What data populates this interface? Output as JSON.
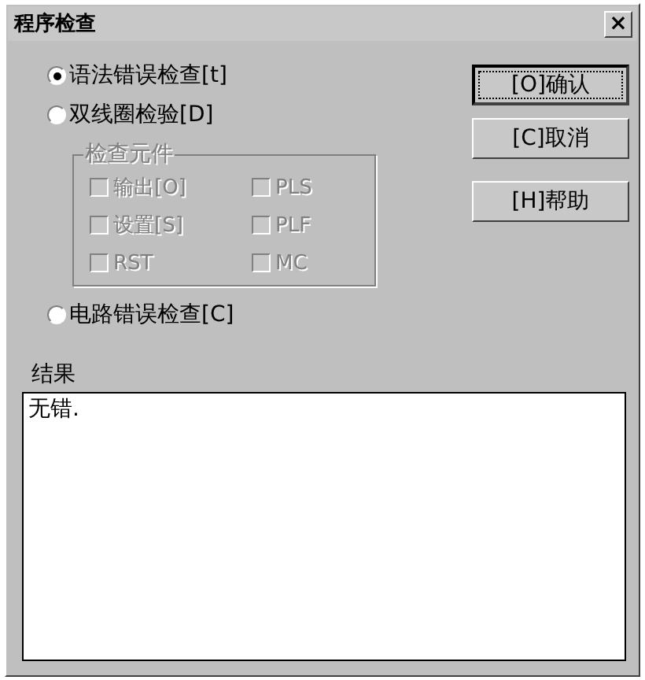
{
  "window": {
    "title": "程序检查",
    "close": "×"
  },
  "modes": [
    {
      "label": "语法错误检查[t]",
      "selected": true
    },
    {
      "label": "双线圈检验[D]",
      "selected": false
    }
  ],
  "element_group": {
    "title": "检查元件",
    "disabled": true,
    "items": [
      {
        "label": "输出[O]",
        "checked": false
      },
      {
        "label": "PLS",
        "checked": false
      },
      {
        "label": "设置[S]",
        "checked": false
      },
      {
        "label": "PLF",
        "checked": false
      },
      {
        "label": "RST",
        "checked": false
      },
      {
        "label": "MC",
        "checked": false
      }
    ]
  },
  "mode_circuit": {
    "label": "电路错误检查[C]",
    "selected": false
  },
  "buttons": [
    {
      "label": "[O]确认",
      "default": true
    },
    {
      "label": "[C]取消",
      "default": false
    },
    {
      "label": "[H]帮助",
      "default": false
    }
  ],
  "result": {
    "label": "结果",
    "value": "无错."
  }
}
